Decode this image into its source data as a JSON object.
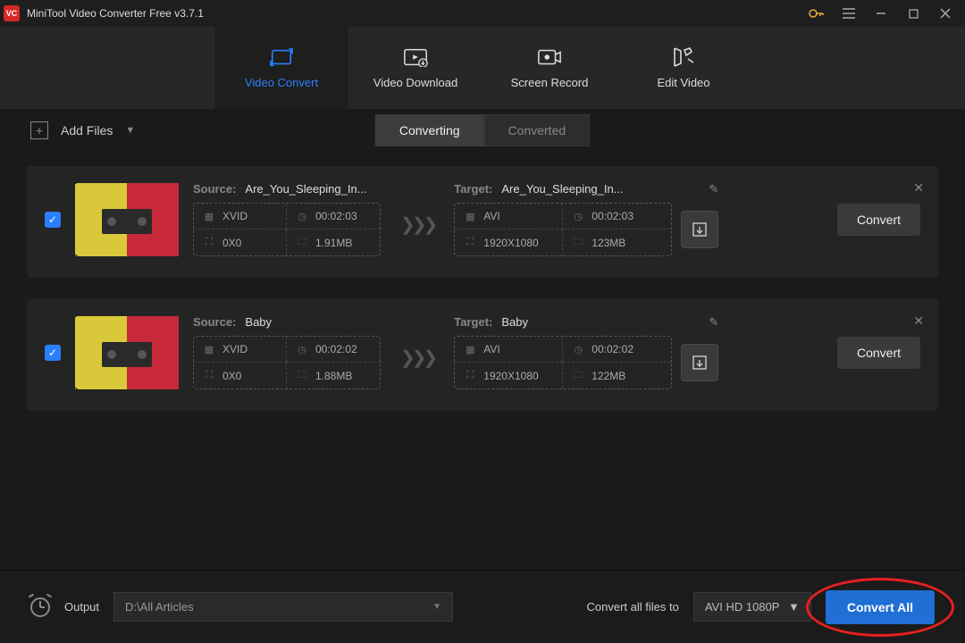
{
  "title": "MiniTool Video Converter Free v3.7.1",
  "tabs": {
    "video_convert": "Video Convert",
    "video_download": "Video Download",
    "screen_record": "Screen Record",
    "edit_video": "Edit Video"
  },
  "toolbar": {
    "add_files": "Add Files",
    "converting": "Converting",
    "converted": "Converted"
  },
  "labels": {
    "source": "Source:",
    "target": "Target:",
    "convert": "Convert"
  },
  "items": [
    {
      "source_name": "Are_You_Sleeping_In...",
      "src_codec": "XVID",
      "src_dur": "00:02:03",
      "src_res": "0X0",
      "src_size": "1.91MB",
      "target_name": "Are_You_Sleeping_In...",
      "tgt_codec": "AVI",
      "tgt_dur": "00:02:03",
      "tgt_res": "1920X1080",
      "tgt_size": "123MB"
    },
    {
      "source_name": "Baby",
      "src_codec": "XVID",
      "src_dur": "00:02:02",
      "src_res": "0X0",
      "src_size": "1.88MB",
      "target_name": "Baby",
      "tgt_codec": "AVI",
      "tgt_dur": "00:02:02",
      "tgt_res": "1920X1080",
      "tgt_size": "122MB"
    }
  ],
  "bottom": {
    "output_label": "Output",
    "output_path": "D:\\All Articles",
    "convert_all_label": "Convert all files to",
    "preset": "AVI HD 1080P",
    "convert_all_btn": "Convert All"
  }
}
